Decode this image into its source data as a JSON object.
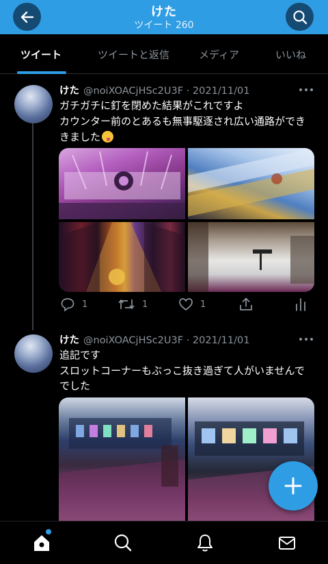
{
  "header": {
    "title": "けた",
    "subtitle": "ツイート 260",
    "back_icon": "arrow-left-icon",
    "search_icon": "search-icon"
  },
  "tabs": [
    {
      "label": "ツイート",
      "active": true
    },
    {
      "label": "ツイートと返信",
      "active": false
    },
    {
      "label": "メディア",
      "active": false
    },
    {
      "label": "いいね",
      "active": false
    }
  ],
  "tweets": [
    {
      "name": "けた",
      "handle": "@noiXOACjHSc2U3F",
      "separator": "·",
      "date": "2021/11/01",
      "lines": [
        "ガチガチに釘を閉めた結果がこれですよ",
        "カウンター前のとあるも無事駆逐され広い通路ができ",
        "きました"
      ],
      "emoji": "zany-face-emoji",
      "replies": "1",
      "retweets": "1",
      "likes": "1"
    },
    {
      "name": "けた",
      "handle": "@noiXOACjHSc2U3F",
      "separator": "·",
      "date": "2021/11/01",
      "lines": [
        "追記です",
        "スロットコーナーもぶっこ抜き過ぎて人がいませんで",
        "でした"
      ]
    }
  ],
  "fab": {
    "icon": "plus-icon"
  },
  "bottom_nav": [
    "home-icon",
    "search-icon",
    "bell-icon",
    "mail-icon"
  ],
  "colors": {
    "accent": "#2f9de4",
    "header_btn": "#154a73",
    "muted": "#8b949c",
    "background": "#000000"
  }
}
